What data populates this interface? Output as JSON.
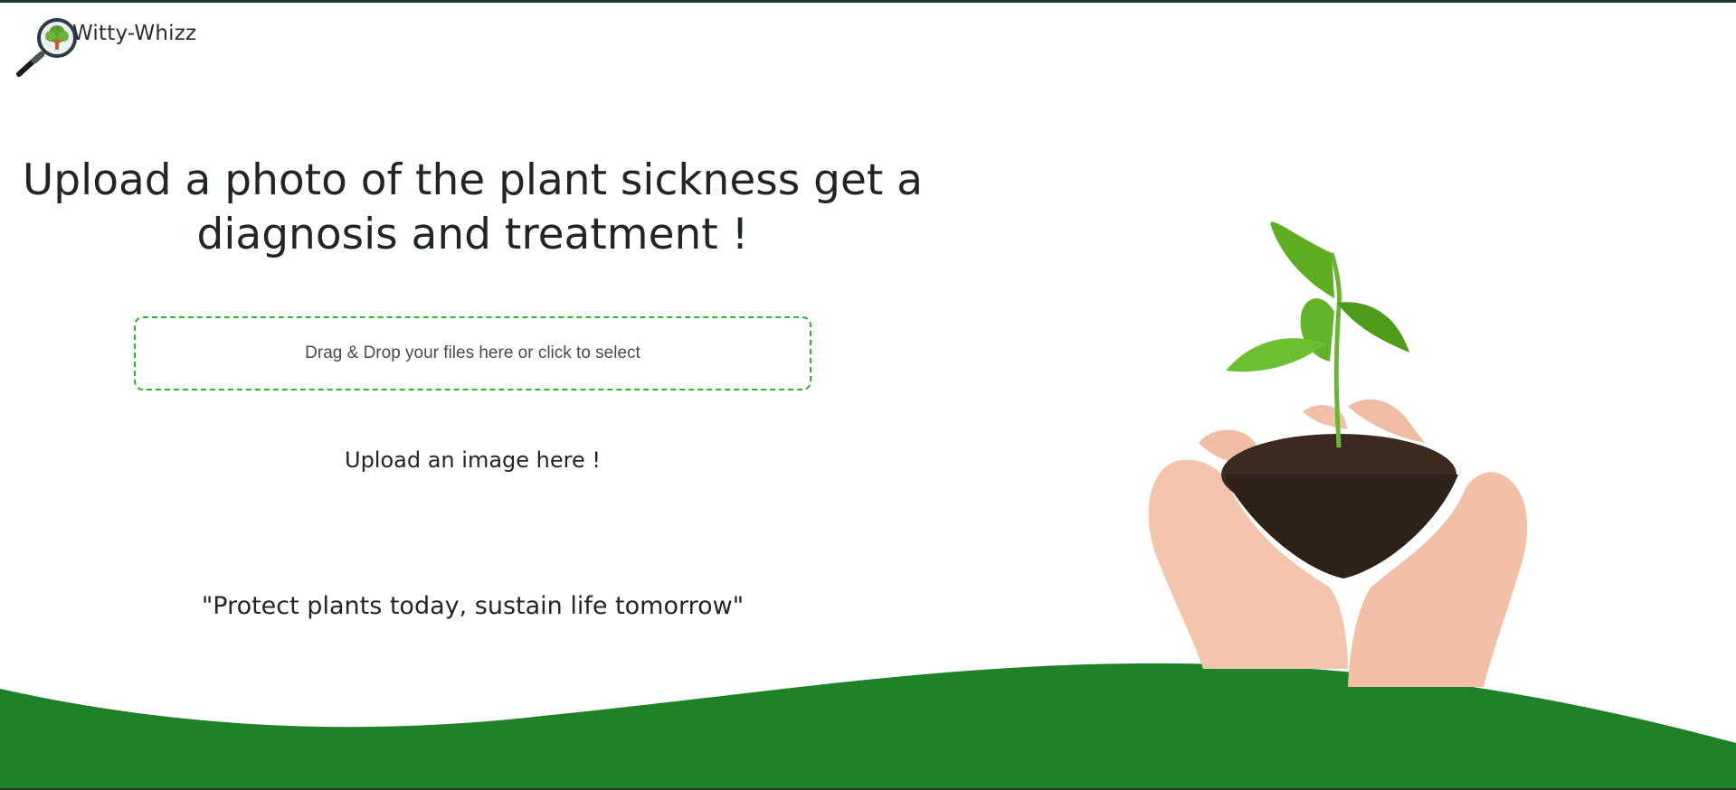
{
  "header": {
    "brand_name": "Witty-Whizz",
    "logo_icon": "magnifier-tree-icon"
  },
  "hero": {
    "headline": "Upload a photo of the plant sickness get a diagnosis and treatment !",
    "dropzone_text": "Drag & Drop your files here or click to select",
    "upload_label": "Upload an image here !",
    "quote": "\"Protect plants today, sustain life tomorrow\""
  },
  "illustration": {
    "icon": "hands-holding-sprout-icon"
  },
  "colors": {
    "accent_green": "#1f8228",
    "dropzone_border": "#2cb52c",
    "border_dark": "#1d3b2a",
    "text": "#212529"
  }
}
